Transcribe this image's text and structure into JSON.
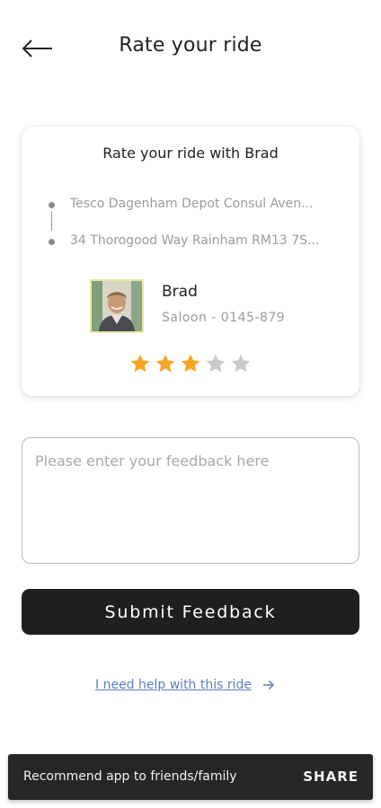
{
  "header": {
    "back_icon": "arrow-left-icon",
    "title": "Rate your ride"
  },
  "card": {
    "title": "Rate your ride with Brad",
    "pickup": "Tesco Dagenham Depot Consul Aven...",
    "dropoff": "34 Thorogood Way Rainham RM13 7S...",
    "driver": {
      "name": "Brad",
      "vehicle": "Saloon - 0145-879",
      "avatar_icon": "driver-photo"
    },
    "rating": {
      "value": 3,
      "max": 5,
      "filled_color": "#f5a623",
      "empty_color": "#c9c9c9"
    }
  },
  "feedback": {
    "placeholder": "Please enter your feedback here",
    "value": ""
  },
  "submit": {
    "label": "Submit Feedback"
  },
  "help": {
    "label": "I need help with this ride",
    "icon": "arrow-right-icon"
  },
  "snackbar": {
    "message": "Recommend app to friends/family",
    "action": "SHARE"
  },
  "colors": {
    "dark": "#1f1f1f",
    "link": "#5a7fc0",
    "muted": "#9b9b9b"
  }
}
